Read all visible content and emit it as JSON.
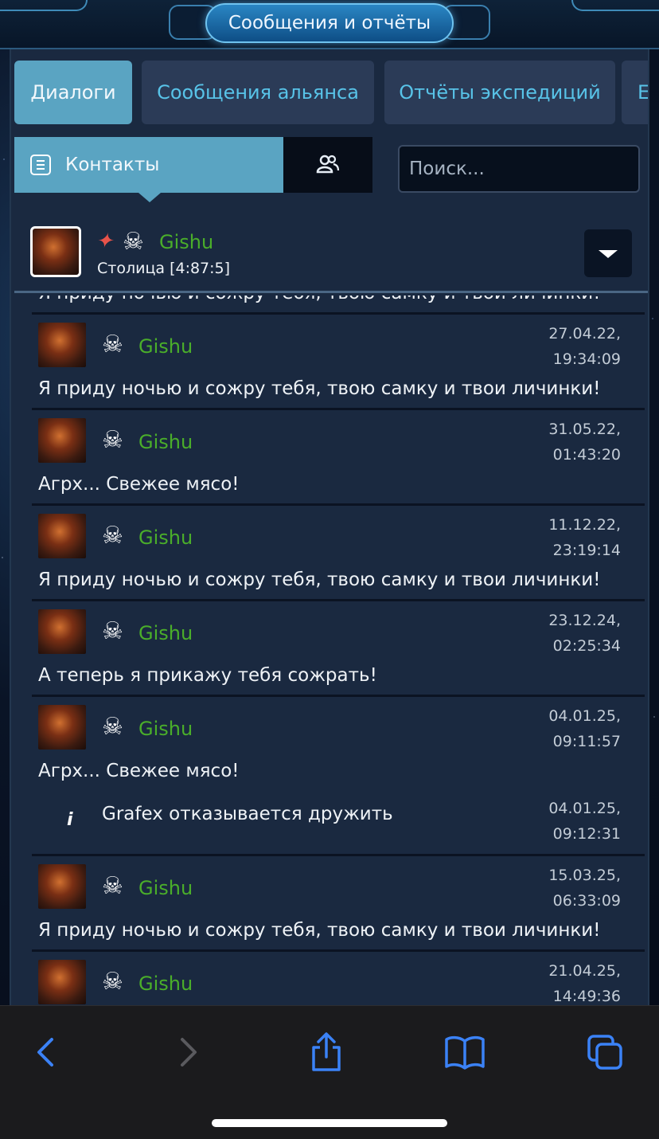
{
  "header": {
    "title": "Сообщения и отчёты"
  },
  "tabs": [
    {
      "label": "Диалоги",
      "active": true
    },
    {
      "label": "Сообщения альянса",
      "active": false
    },
    {
      "label": "Отчёты экспедиций",
      "active": false
    },
    {
      "label": "E",
      "active": false
    }
  ],
  "subbar": {
    "contacts_label": "Контакты",
    "search_placeholder": "Поиск..."
  },
  "contact": {
    "name": "Gishu",
    "location": "Столица [4:87:5]"
  },
  "partial_message": "Я приду ночью и сожру тебя, твою самку и твои личинки!",
  "messages": [
    {
      "sender": "Gishu",
      "date": "27.04.22,",
      "time": "19:34:09",
      "text": "Я приду ночью и сожру тебя, твою самку и твои личинки!"
    },
    {
      "sender": "Gishu",
      "date": "31.05.22,",
      "time": "01:43:20",
      "text": "Агрх... Свежее мясо!"
    },
    {
      "sender": "Gishu",
      "date": "11.12.22,",
      "time": "23:19:14",
      "text": "Я приду ночью и сожру тебя, твою самку и твои личинки!"
    },
    {
      "sender": "Gishu",
      "date": "23.12.24,",
      "time": "02:25:34",
      "text": "А теперь я прикажу тебя сожрать!"
    },
    {
      "sender": "Gishu",
      "date": "04.01.25,",
      "time": "09:11:57",
      "text": "Агрх... Свежее мясо!"
    },
    {
      "sender": "Gishu",
      "date": "15.03.25,",
      "time": "06:33:09",
      "text": "Я приду ночью и сожру тебя, твою самку и твои личинки!"
    },
    {
      "sender": "Gishu",
      "date": "21.04.25,",
      "time": "14:49:36",
      "text": ""
    }
  ],
  "system_message": {
    "text": "Grafex отказывается дружить",
    "date": "04.01.25,",
    "time": "09:12:31"
  },
  "colors": {
    "accent": "#5aa4c2",
    "tab_text": "#58c3e8",
    "player_name": "#4aae2a",
    "safari_blue": "#3b82f6"
  }
}
